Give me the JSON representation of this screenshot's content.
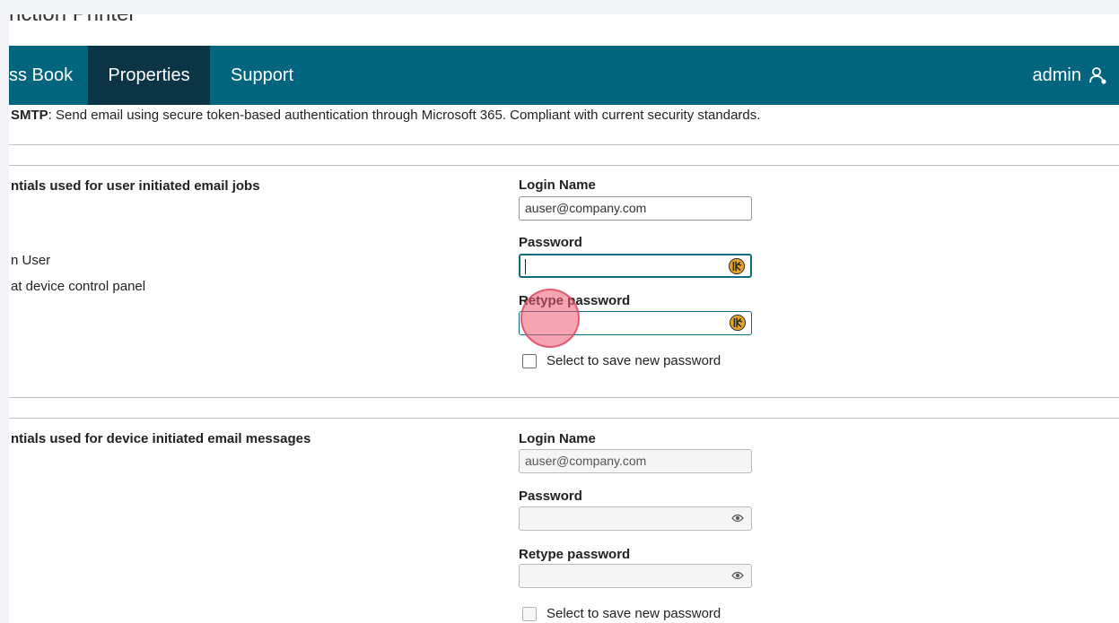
{
  "window": {
    "title": "nction Printer"
  },
  "nav": {
    "items": [
      {
        "label": "ss Book"
      },
      {
        "label": "Properties"
      },
      {
        "label": "Support"
      }
    ],
    "user": "admin"
  },
  "smtp_note": {
    "bold": "SMTP",
    "text": ": Send email using secure token-based authentication through Microsoft 365. Compliant with current security standards."
  },
  "user_section": {
    "title": "ntials used for user initiated email jobs",
    "options": [
      "n User",
      "at device control panel"
    ],
    "login_label": "Login Name",
    "login_value": "auser@company.com",
    "password_label": "Password",
    "password_value": "",
    "retype_label": "Retype password",
    "retype_value": "",
    "save_label": "Select to save new password"
  },
  "device_section": {
    "title": "ntials used for device initiated email messages",
    "login_label": "Login Name",
    "login_value": "auser@company.com",
    "password_label": "Password",
    "password_value": "",
    "retype_label": "Retype password",
    "retype_value": "",
    "save_label": "Select to save new password"
  },
  "colors": {
    "nav_bg": "#016580",
    "nav_active": "#0b3445",
    "focus_border": "#0d6b84",
    "password_manager_icon": "#e0a22a",
    "click_marker": "#ee5a6e"
  },
  "icons": {
    "user": "user-icon",
    "password_manager": "password-manager-icon",
    "show_password": "eye-icon"
  }
}
